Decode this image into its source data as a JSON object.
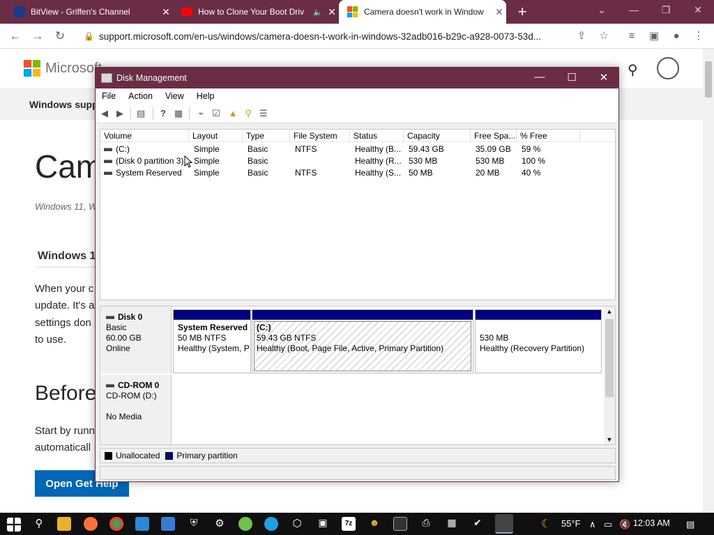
{
  "browser": {
    "tabs": [
      {
        "title": "BitView - Griffen's Channel",
        "favicon": "bitview-icon",
        "color": "#1a3a8c"
      },
      {
        "title": "How to Clone Your Boot Driv",
        "favicon": "youtube-icon",
        "color": "#ff0000"
      },
      {
        "title": "Camera doesn't work in Window",
        "favicon": "microsoft-icon",
        "active": true
      }
    ],
    "url": "support.microsoft.com/en-us/windows/camera-doesn-t-work-in-windows-32adb016-b29c-a928-0073-53d...",
    "accent": "#6b2d45"
  },
  "webpage": {
    "brand": "Microsoft",
    "site_name": "Windows suppo",
    "title": "Cam",
    "applies": "Windows 11, W",
    "section_heading": "Windows 1",
    "body_lines": [
      "When your c",
      "update. It's a",
      "settings don",
      "to use."
    ],
    "before_heading": "Before",
    "start_lines": [
      "Start by runn",
      "automaticall"
    ],
    "get_help_label": "Open Get Help",
    "link_color": "#0067b8"
  },
  "disk_management": {
    "title": "Disk Management",
    "menu": [
      "File",
      "Action",
      "View",
      "Help"
    ],
    "columns": [
      "Volume",
      "Layout",
      "Type",
      "File System",
      "Status",
      "Capacity",
      "Free Spa...",
      "% Free"
    ],
    "volumes": [
      {
        "volume": "(C:)",
        "layout": "Simple",
        "type": "Basic",
        "fs": "NTFS",
        "status": "Healthy (B...",
        "capacity": "59.43 GB",
        "free": "35.09 GB",
        "pct": "59 %"
      },
      {
        "volume": "(Disk 0 partition 3)",
        "layout": "Simple",
        "type": "Basic",
        "fs": "",
        "status": "Healthy (R...",
        "capacity": "530 MB",
        "free": "530 MB",
        "pct": "100 %"
      },
      {
        "volume": "System Reserved",
        "layout": "Simple",
        "type": "Basic",
        "fs": "NTFS",
        "status": "Healthy (S...",
        "capacity": "50 MB",
        "free": "20 MB",
        "pct": "40 %"
      }
    ],
    "disks": [
      {
        "name": "Disk 0",
        "kind": "Basic",
        "size": "60.00 GB",
        "state": "Online",
        "partitions": [
          {
            "name": "System Reserved",
            "size": "50 MB NTFS",
            "status": "Healthy (System, P"
          },
          {
            "name": "(C:)",
            "size": "59.43 GB NTFS",
            "status": "Healthy (Boot, Page File, Active, Primary Partition)"
          },
          {
            "name": "",
            "size": "530 MB",
            "status": "Healthy (Recovery Partition)"
          }
        ]
      },
      {
        "name": "CD-ROM 0",
        "kind": "CD-ROM (D:)",
        "size": "",
        "state": "No Media"
      }
    ],
    "legend": [
      {
        "label": "Unallocated",
        "color": "#000000"
      },
      {
        "label": "Primary partition",
        "color": "#00007f"
      }
    ]
  },
  "taskbar": {
    "weather": "55°F",
    "time": "12:03 AM"
  }
}
